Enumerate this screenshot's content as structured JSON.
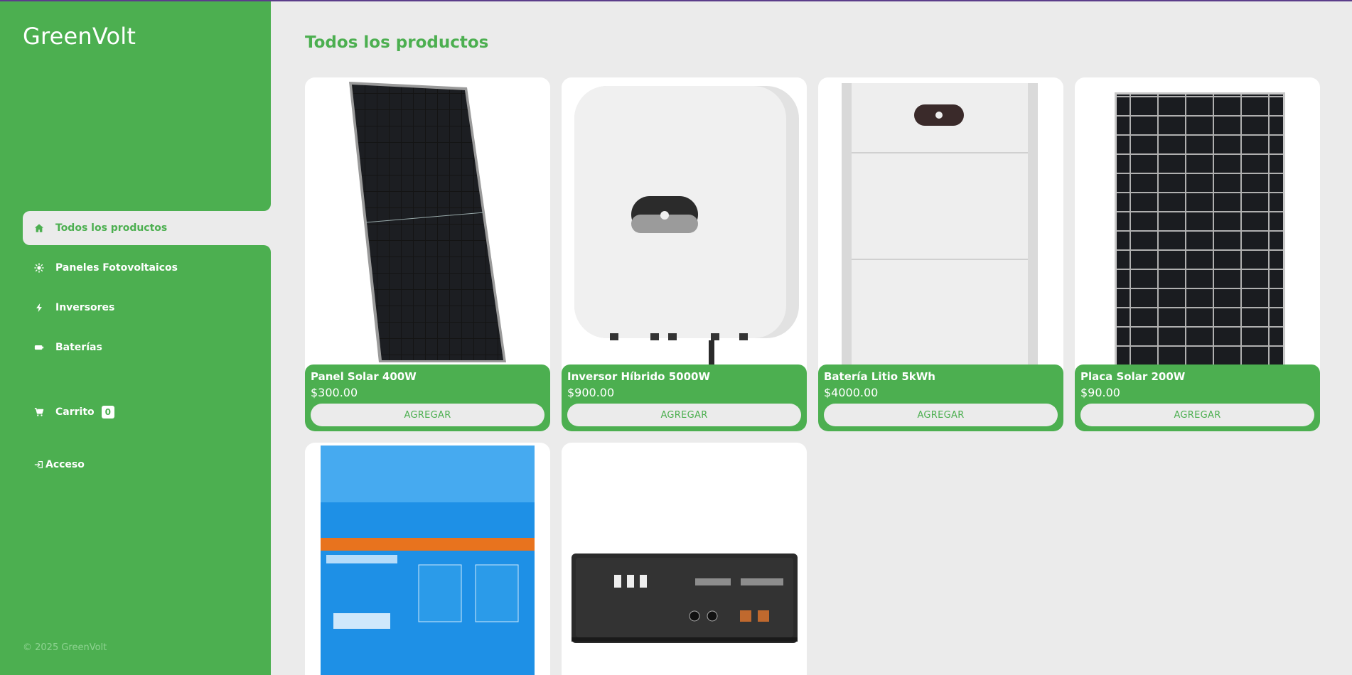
{
  "brand": "GreenVolt",
  "nav": {
    "items": [
      {
        "label": "Todos los productos",
        "icon": "home-icon"
      },
      {
        "label": "Paneles Fotovoltaicos",
        "icon": "sun-icon"
      },
      {
        "label": "Inversores",
        "icon": "bolt-icon"
      },
      {
        "label": "Baterías",
        "icon": "battery-icon"
      }
    ],
    "cart_label": "Carrito",
    "cart_count": "0",
    "login_label": "Acceso"
  },
  "footer": "© 2025 GreenVolt",
  "main": {
    "title": "Todos los productos",
    "add_label": "AGREGAR",
    "products": [
      {
        "name": "Panel Solar 400W",
        "price": "$300.00"
      },
      {
        "name": "Inversor Híbrido 5000W",
        "price": "$900.00"
      },
      {
        "name": "Batería Litio 5kWh",
        "price": "$4000.00"
      },
      {
        "name": "Placa Solar 200W",
        "price": "$90.00"
      },
      {
        "name": "",
        "price": ""
      },
      {
        "name": "",
        "price": ""
      }
    ]
  },
  "colors": {
    "brand_green": "#4caf50",
    "background": "#ebebeb"
  }
}
